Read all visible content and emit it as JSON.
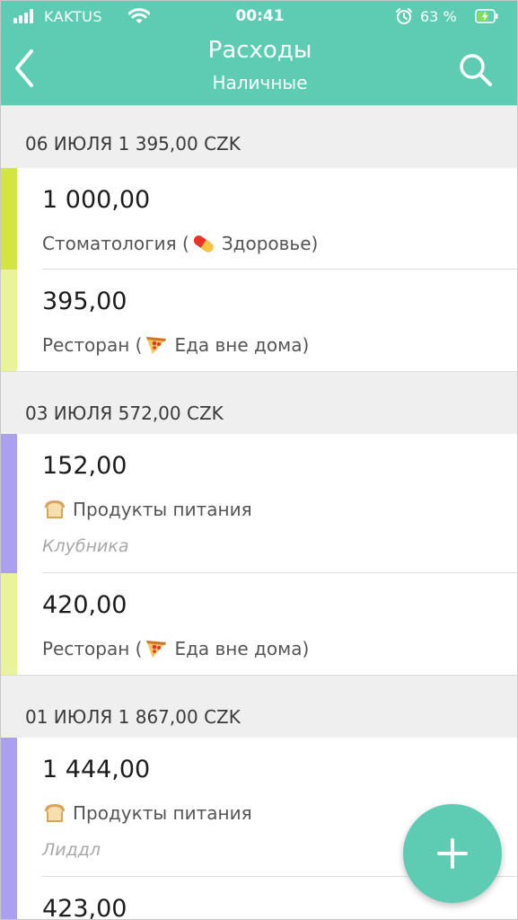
{
  "status_bar": {
    "carrier": "KAKTUS",
    "time": "00:41",
    "battery": "63 %",
    "icons": [
      "signal-icon",
      "wifi-icon",
      "alarm-icon",
      "battery-charging-icon"
    ]
  },
  "nav": {
    "title": "Расходы",
    "subtitle": "Наличные",
    "back_icon": "chevron-left-icon",
    "search_icon": "search-icon"
  },
  "groups": [
    {
      "header": "06 ИЮЛЯ 1 395,00 CZK",
      "entries": [
        {
          "amount": "1 000,00",
          "category_prefix": "Стоматология (",
          "category_icon": "pill-emoji",
          "category_suffix": "Здоровье)",
          "color": "#d2e542"
        },
        {
          "amount": "395,00",
          "category_prefix": "Ресторан (",
          "category_icon": "pizza-emoji",
          "category_suffix": "Еда вне дома)",
          "color": "#eaf29c"
        }
      ]
    },
    {
      "header": "03 ИЮЛЯ 572,00 CZK",
      "entries": [
        {
          "amount": "152,00",
          "category_icon": "bread-emoji",
          "category_label": "Продукты питания",
          "note": "Клубника",
          "color": "#ab9ff0"
        },
        {
          "amount": "420,00",
          "category_prefix": "Ресторан (",
          "category_icon": "pizza-emoji",
          "category_suffix": "Еда вне дома)",
          "color": "#eaf29c"
        }
      ]
    },
    {
      "header": "01 ИЮЛЯ 1 867,00 CZK",
      "entries": [
        {
          "amount": "1 444,00",
          "category_icon": "bread-emoji",
          "category_label": "Продукты питания",
          "note": "Лиддл",
          "color": "#ab9ff0"
        },
        {
          "amount": "423,00",
          "color": "#ab9ff0"
        }
      ]
    }
  ],
  "fab": {
    "icon": "plus-icon"
  },
  "colors": {
    "accent": "#5ecbb3",
    "background": "#efefef"
  }
}
